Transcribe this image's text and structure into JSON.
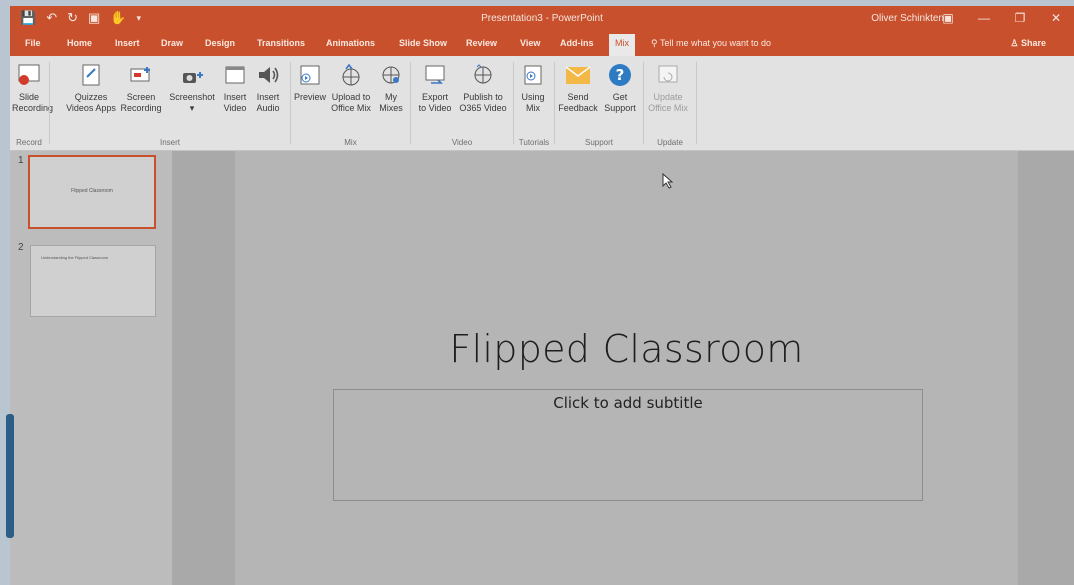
{
  "window": {
    "title": "Presentation3 - PowerPoint",
    "user": "Oliver Schinkten"
  },
  "tabs": [
    {
      "label": "File"
    },
    {
      "label": "Home"
    },
    {
      "label": "Insert"
    },
    {
      "label": "Draw"
    },
    {
      "label": "Design"
    },
    {
      "label": "Transitions"
    },
    {
      "label": "Animations"
    },
    {
      "label": "Slide Show"
    },
    {
      "label": "Review"
    },
    {
      "label": "View"
    },
    {
      "label": "Add-ins"
    },
    {
      "label": "Mix"
    }
  ],
  "tell_me": "Tell me what you want to do",
  "share": "Share",
  "ribbon": {
    "buttons": [
      {
        "l1": "Slide",
        "l2": "Recording",
        "icon": "slide-recording-icon"
      },
      {
        "l1": "Quizzes",
        "l2": "Videos Apps",
        "icon": "quizzes-icon"
      },
      {
        "l1": "Screen",
        "l2": "Recording",
        "icon": "screen-recording-icon"
      },
      {
        "l1": "Screenshot",
        "l2": "▾",
        "icon": "camera-icon"
      },
      {
        "l1": "Insert",
        "l2": "Video",
        "icon": "insert-video-icon"
      },
      {
        "l1": "Insert",
        "l2": "Audio",
        "icon": "speaker-icon"
      },
      {
        "l1": "Preview",
        "l2": "",
        "icon": "preview-icon"
      },
      {
        "l1": "Upload to",
        "l2": "Office Mix",
        "icon": "upload-globe-icon"
      },
      {
        "l1": "My",
        "l2": "Mixes",
        "icon": "my-mixes-icon"
      },
      {
        "l1": "Export",
        "l2": "to Video",
        "icon": "export-video-icon"
      },
      {
        "l1": "Publish to",
        "l2": "O365 Video",
        "icon": "publish-globe-icon"
      },
      {
        "l1": "Using",
        "l2": "Mix",
        "icon": "using-mix-icon"
      },
      {
        "l1": "Send",
        "l2": "Feedback",
        "icon": "envelope-icon"
      },
      {
        "l1": "Get",
        "l2": "Support",
        "icon": "help-icon"
      },
      {
        "l1": "Update",
        "l2": "Office Mix",
        "icon": "update-icon"
      }
    ],
    "groups": [
      {
        "label": "Record"
      },
      {
        "label": "Insert"
      },
      {
        "label": "Mix"
      },
      {
        "label": "Video"
      },
      {
        "label": "Tutorials"
      },
      {
        "label": "Support"
      },
      {
        "label": "Update"
      }
    ]
  },
  "slides": [
    {
      "num": "1",
      "title": "Flipped Classroom"
    },
    {
      "num": "2",
      "title": "Understanding the Flipped Classroom"
    }
  ],
  "current_slide": {
    "title": "Flipped Classroom",
    "subtitle": "Click to add subtitle"
  },
  "colors": {
    "accent": "#c8502c",
    "ribbon": "#e2e2e2"
  }
}
